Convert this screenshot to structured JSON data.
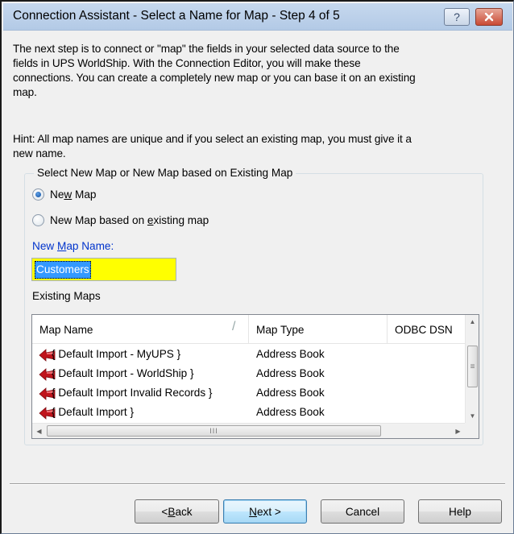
{
  "window": {
    "title": "Connection Assistant - Select a Name for Map - Step 4 of 5",
    "help_glyph": "?"
  },
  "intro": {
    "line1": "The next step is to connect or \"map\" the fields in your selected data source to the",
    "line2": "fields in UPS WorldShip. With the Connection Editor, you will make these",
    "line3": "connections. You can create a completely new map or you can base it on an existing",
    "line4": "map."
  },
  "hint": {
    "line1": "Hint: All map names are unique and if you select an existing map, you must give it a",
    "line2": "new name."
  },
  "group": {
    "legend": "Select New Map or New Map based on Existing Map",
    "radio_new_pre": "Ne",
    "radio_new_u": "w",
    "radio_new_post": " Map",
    "radio_existing_pre": "New Map based on ",
    "radio_existing_u": "e",
    "radio_existing_post": "xisting map",
    "selected": "New Map"
  },
  "map_name": {
    "label_pre": "New ",
    "label_u": "M",
    "label_post": "ap Name:",
    "value": "Customers",
    "highlight_color": "#ffff00"
  },
  "existing_maps": {
    "label": "Existing Maps",
    "columns": [
      "Map Name",
      "Map Type",
      "ODBC DSN"
    ],
    "column_sep": "/",
    "rows": [
      {
        "name": "{ Default Import - MyUPS }",
        "type": "Address Book"
      },
      {
        "name": "{ Default Import - WorldShip }",
        "type": "Address Book"
      },
      {
        "name": "{ Default Import Invalid Records }",
        "type": "Address Book"
      },
      {
        "name": "{ Default Import }",
        "type": "Address Book"
      }
    ],
    "row_icon": "red-arrow-icon",
    "hscroll_grip": "III"
  },
  "buttons": {
    "back_pre": "< ",
    "back_u": "B",
    "back_post": "ack",
    "next_pre": "",
    "next_u": "N",
    "next_post": "ext >",
    "cancel": "Cancel",
    "help": "Help"
  },
  "colors": {
    "accent_link": "#0033cc",
    "selection": "#3399ff",
    "icon_red": "#c0141c"
  }
}
